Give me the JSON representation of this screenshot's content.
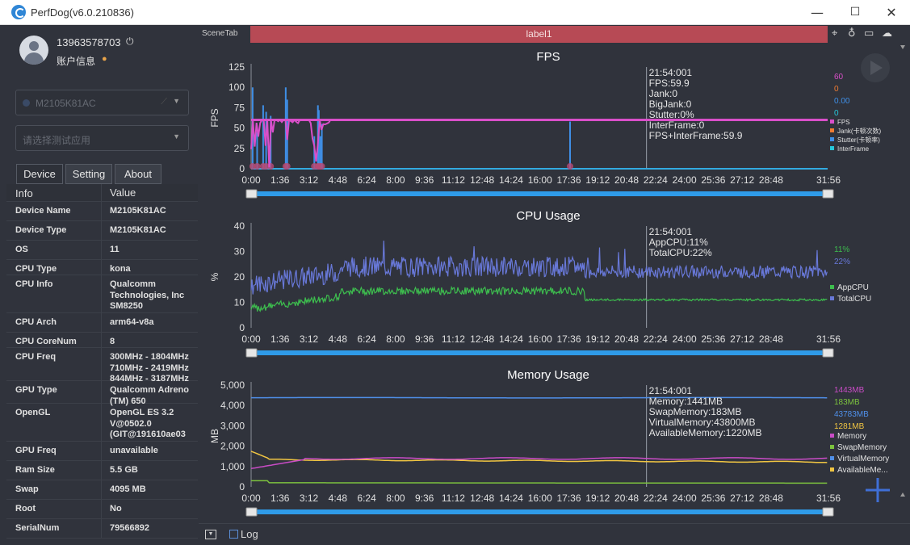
{
  "window": {
    "title": "PerfDog(v6.0.210836)",
    "minimize": "—",
    "maximize": "☐",
    "close": "✕"
  },
  "user": {
    "phone": "13963578703",
    "account_label": "账户信息"
  },
  "device_select": {
    "value": "M2105K81AC"
  },
  "app_select": {
    "placeholder": "请选择测试应用"
  },
  "tabs": [
    {
      "label": "Device",
      "active": true
    },
    {
      "label": "Setting",
      "active": false
    },
    {
      "label": "About",
      "active": false
    }
  ],
  "info_table": {
    "headers": [
      "Info",
      "Value"
    ],
    "rows": [
      {
        "key": "Device Name",
        "value": "M2105K81AC"
      },
      {
        "key": "Device Type",
        "value": "M2105K81AC"
      },
      {
        "key": "OS",
        "value": "11"
      },
      {
        "key": "CPU Type",
        "value": "kona"
      },
      {
        "key": "CPU Info",
        "value": "Qualcomm Technologies, Inc SM8250"
      },
      {
        "key": "CPU Arch",
        "value": "arm64-v8a"
      },
      {
        "key": "CPU CoreNum",
        "value": "8"
      },
      {
        "key": "CPU Freq",
        "value": "300MHz - 1804MHz 710MHz - 2419MHz 844MHz - 3187MHz"
      },
      {
        "key": "GPU Type",
        "value": "Qualcomm Adreno (TM) 650"
      },
      {
        "key": "OpenGL",
        "value": "OpenGL ES 3.2 V@0502.0 (GIT@191610ae03"
      },
      {
        "key": "GPU Freq",
        "value": "unavailable"
      },
      {
        "key": "Ram Size",
        "value": "5.5 GB"
      },
      {
        "key": "Swap",
        "value": "4095 MB"
      },
      {
        "key": "Root",
        "value": "No"
      },
      {
        "key": "SerialNum",
        "value": "79566892"
      }
    ]
  },
  "scene": {
    "tab_label": "SceneTab",
    "label": "label1"
  },
  "bottom": {
    "log_label": "Log"
  },
  "colors": {
    "fps": "#d94fc9",
    "jank": "#f07c32",
    "stutter": "#3f8fe6",
    "interframe": "#26c7d9",
    "appcpu": "#3dbd4e",
    "totalcpu": "#6878d8",
    "memory": "#c94cc6",
    "swap": "#7cc23e",
    "virtual": "#4f8fe8",
    "available": "#f0c542"
  },
  "chart_data": [
    {
      "type": "line",
      "title": "FPS",
      "ylabel": "FPS",
      "ylim": [
        0,
        125
      ],
      "yticks": [
        "125",
        "100",
        "75",
        "50",
        "25",
        "0"
      ],
      "xticks": [
        "0:00",
        "1:36",
        "3:12",
        "4:48",
        "6:24",
        "8:00",
        "9:36",
        "11:12",
        "12:48",
        "14:24",
        "16:00",
        "17:36",
        "19:12",
        "20:48",
        "22:24",
        "24:00",
        "25:36",
        "27:12",
        "28:48",
        "31:56"
      ],
      "cursor": {
        "time": "21:54:001",
        "lines": [
          "21:54:001",
          "FPS:59.9",
          "Jank:0",
          "BigJank:0",
          "Stutter:0%",
          "InterFrame:0",
          "FPS+InterFrame:59.9"
        ]
      },
      "current_values": [
        "60",
        "0",
        "0.00",
        "0"
      ],
      "series": [
        {
          "name": "FPS",
          "value": 60,
          "color_key": "fps"
        },
        {
          "name": "Jank(卡顿次数)",
          "value": 0,
          "color_key": "jank"
        },
        {
          "name": "Stutter(卡顿率)",
          "value": 0,
          "color_key": "stutter"
        },
        {
          "name": "InterFrame",
          "value": 0,
          "color_key": "interframe"
        }
      ],
      "spike_times": [
        "0:05",
        "0:20",
        "0:40",
        "0:50",
        "1:05",
        "1:55",
        "2:00",
        "3:30",
        "3:42",
        "3:45",
        "3:50",
        "3:55",
        "17:40"
      ],
      "spike_values": [
        100,
        45,
        78,
        70,
        65,
        100,
        85,
        40,
        78,
        72,
        40,
        55,
        58
      ]
    },
    {
      "type": "line",
      "title": "CPU Usage",
      "ylabel": "%",
      "ylim": [
        0,
        40
      ],
      "yticks": [
        "40",
        "30",
        "20",
        "10",
        "0"
      ],
      "xticks": [
        "0:00",
        "1:36",
        "3:12",
        "4:48",
        "6:24",
        "8:00",
        "9:36",
        "11:12",
        "12:48",
        "14:24",
        "16:00",
        "17:36",
        "19:12",
        "20:48",
        "22:24",
        "24:00",
        "25:36",
        "27:12",
        "28:48",
        "31:56"
      ],
      "cursor": {
        "lines": [
          "21:54:001",
          "AppCPU:11%",
          "TotalCPU:22%"
        ]
      },
      "current_values": [
        "11%",
        "22%"
      ],
      "series": [
        {
          "name": "AppCPU",
          "value": 11,
          "color_key": "appcpu"
        },
        {
          "name": "TotalCPU",
          "value": 22,
          "color_key": "totalcpu"
        }
      ]
    },
    {
      "type": "line",
      "title": "Memory Usage",
      "ylabel": "MB",
      "ylim": [
        0,
        5000
      ],
      "yticks": [
        "5,000",
        "4,000",
        "3,000",
        "2,000",
        "1,000",
        "0"
      ],
      "xticks": [
        "0:00",
        "1:36",
        "3:12",
        "4:48",
        "6:24",
        "8:00",
        "9:36",
        "11:12",
        "12:48",
        "14:24",
        "16:00",
        "17:36",
        "19:12",
        "20:48",
        "22:24",
        "24:00",
        "25:36",
        "27:12",
        "28:48",
        "31:56"
      ],
      "cursor": {
        "lines": [
          "21:54:001",
          "Memory:1441MB",
          "SwapMemory:183MB",
          "VirtualMemory:43800MB",
          "AvailableMemory:1220MB"
        ]
      },
      "current_values": [
        "1443MB",
        "183MB",
        "43783MB",
        "1281MB"
      ],
      "series": [
        {
          "name": "Memory",
          "value": 1443,
          "color_key": "memory"
        },
        {
          "name": "SwapMemory",
          "value": 183,
          "color_key": "swap"
        },
        {
          "name": "VirtualMemory",
          "value": 43783,
          "color_key": "virtual"
        },
        {
          "name": "AvailableMe...",
          "value": 1281,
          "color_key": "available"
        }
      ]
    }
  ]
}
